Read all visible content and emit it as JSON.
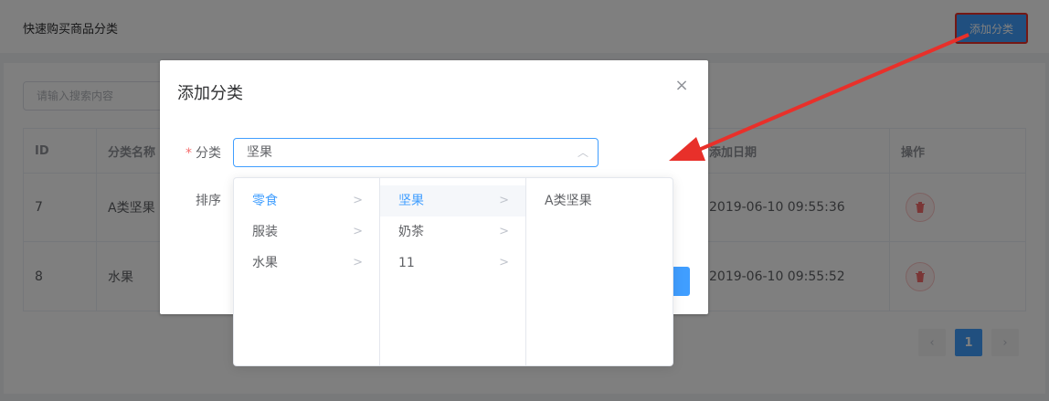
{
  "page": {
    "title": "快速购买商品分类",
    "add_button": "添加分类",
    "search_placeholder": "请输入搜索内容"
  },
  "table": {
    "headers": [
      "ID",
      "分类名称",
      "",
      "添加日期",
      "操作"
    ],
    "rows": [
      {
        "id": "7",
        "name": "A类坚果",
        "date": "2019-06-10 09:55:36"
      },
      {
        "id": "8",
        "name": "水果",
        "date": "2019-06-10 09:55:52"
      }
    ]
  },
  "pagination": {
    "prev": "‹",
    "current": "1",
    "next": "›"
  },
  "dialog": {
    "title": "添加分类",
    "close": "×",
    "category_label": "分类",
    "required_mark": "*",
    "category_value": "坚果",
    "sort_label": "排序"
  },
  "cascader_menu": {
    "col1": [
      "零食",
      "服装",
      "水果"
    ],
    "col2": [
      "坚果",
      "奶茶",
      "11"
    ],
    "col3": [
      "A类坚果"
    ]
  },
  "colors": {
    "primary": "#409eff",
    "annotation": "#e8302a",
    "danger": "#f56c6c"
  }
}
